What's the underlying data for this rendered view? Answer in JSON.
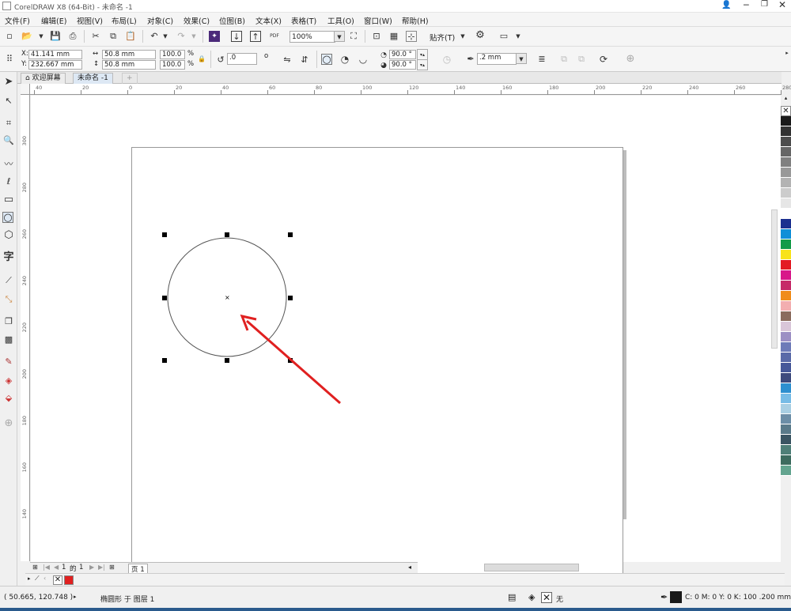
{
  "window": {
    "title": "CorelDRAW X8 (64-Bit) - 未命名 -1"
  },
  "menu": [
    "文件(F)",
    "编辑(E)",
    "视图(V)",
    "布局(L)",
    "对象(C)",
    "效果(C)",
    "位图(B)",
    "文本(X)",
    "表格(T)",
    "工具(O)",
    "窗口(W)",
    "帮助(H)"
  ],
  "toolbar": {
    "zoom": "100%",
    "snap_label": "贴齐(T)",
    "pdf_label": "PDF"
  },
  "props": {
    "x_label": "X:",
    "x_value": "41.141 mm",
    "y_label": "Y:",
    "y_value": "232.667 mm",
    "w_value": "50.8 mm",
    "h_value": "50.8 mm",
    "sx_value": "100.0",
    "sy_value": "100.0",
    "pct": "%",
    "rotate_value": ".0",
    "deg_symbol": "o",
    "angle1": "90.0 °",
    "angle2": "90.0 °",
    "outline_width": ".2 mm"
  },
  "tabs": {
    "welcome": "欢迎屏幕",
    "doc": "未命名 -1"
  },
  "ruler_h": [
    "40",
    "20",
    "0",
    "20",
    "40",
    "60",
    "80",
    "100",
    "120",
    "140",
    "160",
    "180",
    "200",
    "220",
    "240",
    "260",
    "280"
  ],
  "ruler_v": [
    "300",
    "280",
    "260",
    "240",
    "220",
    "200",
    "180",
    "160",
    "140"
  ],
  "pagenav": {
    "current": "1",
    "of": "的",
    "total": "1",
    "page_tab": "页 1"
  },
  "status": {
    "coords": "( 50.665, 120.748 )",
    "object_info": "椭圆形 于 图层 1",
    "fill_none": "无",
    "color_info": "C: 0 M: 0 Y: 0 K: 100  .200 mm"
  },
  "colors": {
    "accent_red": "#e02020",
    "palette": [
      "#1a1a1a",
      "#333333",
      "#4d4d4d",
      "#666666",
      "#808080",
      "#999999",
      "#b3b3b3",
      "#cccccc",
      "#e6e6e6",
      "#ffffff",
      "#1b2f8f",
      "#0f8fd8",
      "#139b48",
      "#f8e31a",
      "#e31b23",
      "#d8188a",
      "#c62a68",
      "#f08c1a",
      "#f3aeb0",
      "#8a6b5d",
      "#d9c6d9",
      "#9c8fc4",
      "#6e7bb8",
      "#5a6aa8",
      "#465899",
      "#3d4a7d",
      "#2d8fcf",
      "#77bce6",
      "#a9cfe3",
      "#6c8ea7",
      "#5a7a8a",
      "#3b5563",
      "#4f7f78",
      "#3d6b5f",
      "#63a48f"
    ]
  }
}
